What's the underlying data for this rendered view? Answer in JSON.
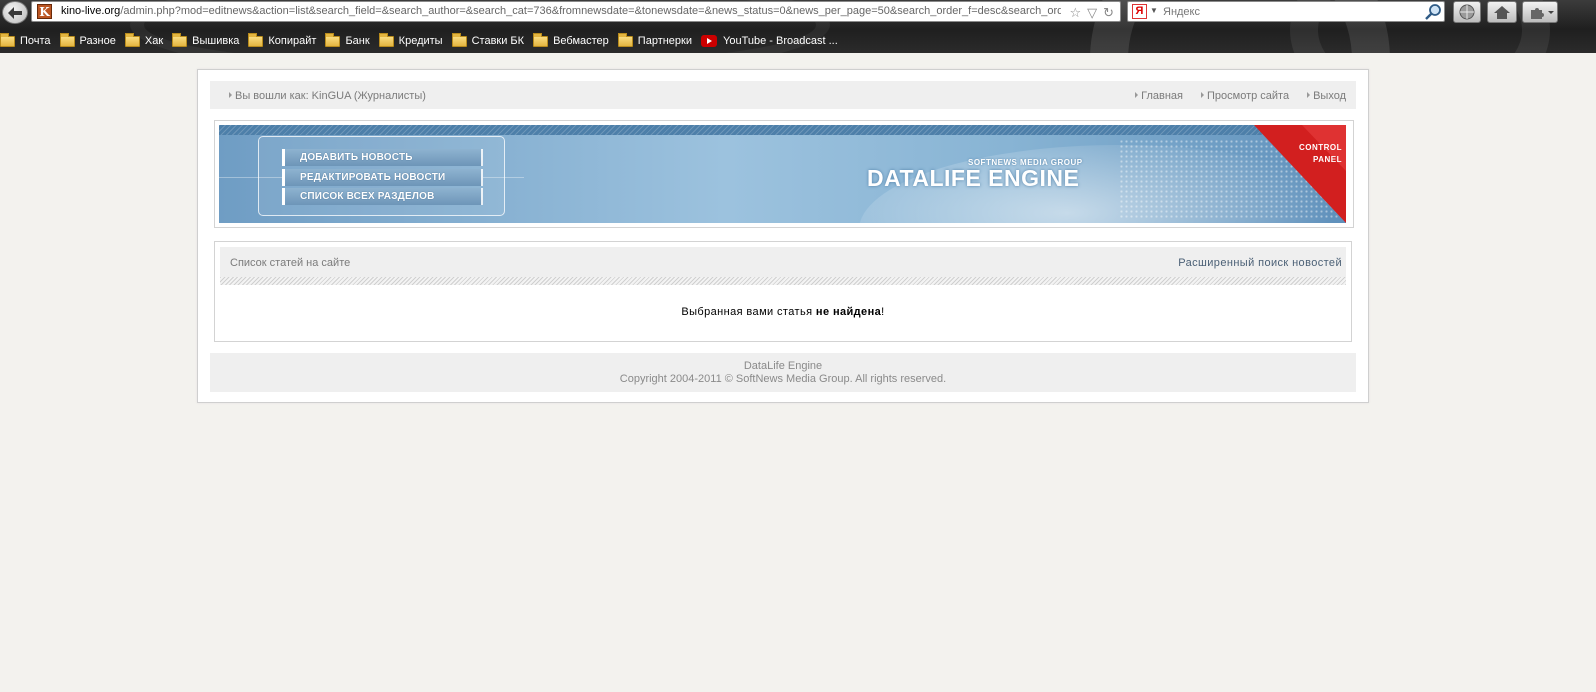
{
  "browser": {
    "url_host": "kino-live.org",
    "url_path": "/admin.php?mod=editnews&action=list&search_field=&search_author=&search_cat=736&fromnewsdate=&tonewsdate=&news_status=0&news_per_page=50&search_order_f=desc&search_order",
    "favicon_letter": "K",
    "search_engine": "Яндекс",
    "search_engine_logo": "Я",
    "bookmarks": [
      {
        "label": "Почта",
        "icon": "folder-icon"
      },
      {
        "label": "Разное",
        "icon": "folder-icon"
      },
      {
        "label": "Хак",
        "icon": "folder-icon"
      },
      {
        "label": "Вышивка",
        "icon": "folder-icon"
      },
      {
        "label": "Копирайт",
        "icon": "folder-icon"
      },
      {
        "label": "Банк",
        "icon": "folder-icon"
      },
      {
        "label": "Кредиты",
        "icon": "folder-icon"
      },
      {
        "label": "Ставки БК",
        "icon": "folder-icon"
      },
      {
        "label": "Вебмастер",
        "icon": "folder-icon"
      },
      {
        "label": "Партнерки",
        "icon": "folder-icon"
      },
      {
        "label": "YouTube - Broadcast ...",
        "icon": "youtube-icon"
      }
    ]
  },
  "topbar": {
    "user_info": "Вы вошли как: KinGUA (Журналисты)",
    "links": {
      "home": "Главная",
      "view_site": "Просмотр сайта",
      "logout": "Выход"
    }
  },
  "banner": {
    "menu": {
      "add_news": "ДОБАВИТЬ НОВОСТЬ",
      "edit_news": "РЕДАКТИРОВАТЬ НОВОСТИ",
      "all_sections": "СПИСОК ВСЕХ РАЗДЕЛОВ"
    },
    "brand_small": "SOFTNEWS MEDIA GROUP",
    "brand_big": "DATALIFE ENGINE",
    "control_panel_line1": "CONTROL",
    "control_panel_line2": "PANEL"
  },
  "content": {
    "title": "Список статей на сайте",
    "advanced_search": "Расширенный поиск новостей",
    "message_prefix": "Выбранная вами статья ",
    "message_bold": "не найдена",
    "message_suffix": "!"
  },
  "footer": {
    "line1": "DataLife Engine",
    "line2": "Copyright 2004-2011 © SoftNews Media Group. All rights reserved."
  },
  "colors": {
    "page_bg": "#f3f2ee",
    "panel_bg": "#efefef",
    "banner_blue": "#88b4d4",
    "corner_red": "#d21f1f",
    "link_blue": "#4a5f75"
  }
}
